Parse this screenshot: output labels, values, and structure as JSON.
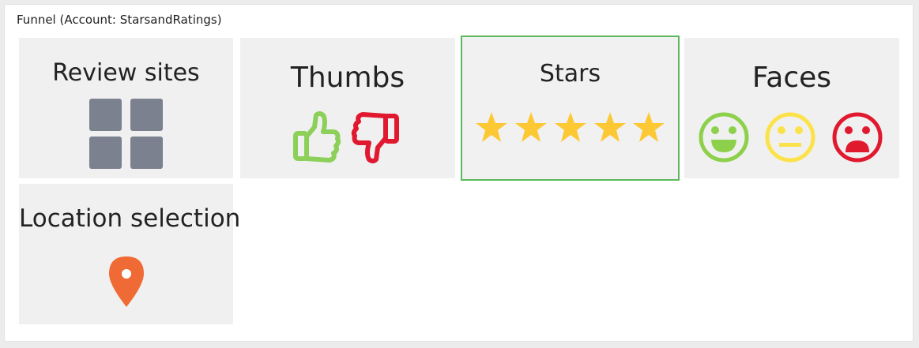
{
  "panel": {
    "title": "Funnel (Account: StarsandRatings)"
  },
  "tiles": [
    {
      "label": "Review sites",
      "icon": "grid-icon",
      "selected": false
    },
    {
      "label": "Thumbs",
      "icon": "thumbs-icon",
      "selected": false
    },
    {
      "label": "Stars",
      "icon": "stars-icon",
      "selected": true
    },
    {
      "label": "Faces",
      "icon": "faces-icon",
      "selected": false
    },
    {
      "label": "Location selection",
      "icon": "map-pin-icon",
      "selected": false
    }
  ],
  "colors": {
    "selected_border": "#5cb85c",
    "tile_background": "#f0f0f0",
    "grid_squares": "#7c8190",
    "thumb_up": "#8cd05a",
    "thumb_down": "#e0192f",
    "star": "#fcc934",
    "face_happy": "#8dd04b",
    "face_neutral": "#fce24a",
    "face_sad": "#e1192f",
    "pin": "#f06a35"
  }
}
